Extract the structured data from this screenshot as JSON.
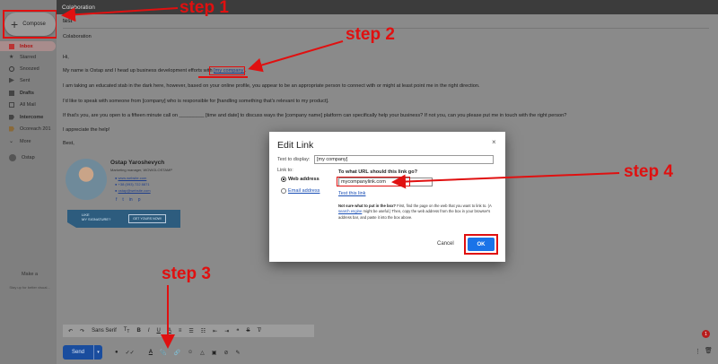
{
  "sidebar": {
    "compose_label": "Compose",
    "items": [
      {
        "label": "Inbox",
        "icon": "inbox-icon",
        "active": true
      },
      {
        "label": "Starred",
        "icon": "star-icon"
      },
      {
        "label": "Snoozed",
        "icon": "clock-icon"
      },
      {
        "label": "Sent",
        "icon": "send-icon"
      },
      {
        "label": "Drafts",
        "icon": "draft-icon"
      },
      {
        "label": "All Mail",
        "icon": "mail-icon"
      },
      {
        "label": "Intercome",
        "icon": "label-icon"
      },
      {
        "label": "Ocoreach 201",
        "icon": "label-icon"
      },
      {
        "label": "More",
        "icon": "chevron-down-icon"
      },
      {
        "label": "Ostap",
        "icon": "avatar-icon"
      }
    ],
    "footer_title": "Make a",
    "footer_text": "Stay up for better visual..."
  },
  "compose": {
    "window_title": "Colaboration",
    "to": "test",
    "subject_line": "Colaboration",
    "greeting": "Hi,",
    "p1_before": "My name is Ostap and I head up business development efforts with ",
    "p1_link": "[my company]",
    "p1_after": ".",
    "p2": "I am taking an educated stab in the dark here, however, based on your online profile, you appear to be an appropriate person to connect with    or might at least point me in the right direction.",
    "p3": "I'd like to speak with someone from [company] who is responsible for [handling something that's relevant to my product].",
    "p4": "If that's you, are you open to a fifteen minute call on _________ [time and date] to discuss ways the [company name] platform can specifically help your business? If not you, can you please put me in touch with the right person?",
    "p5": "I appreciate the help!",
    "signoff": "Best,"
  },
  "signature": {
    "name": "Ostap Yaroshevych",
    "title": "Marketing manager, WOWGLOSTAMP",
    "website": "www.website.com",
    "phone": "+38 (093) 722 8871",
    "email": "ostap@website.com",
    "social": [
      "f",
      "t",
      "in",
      "p"
    ],
    "banner_line1": "LIKE",
    "banner_line2": "MY SIGNATURE?",
    "banner_button": "GET YOURS NOW!"
  },
  "toolbar": {
    "font": "Sans Serif",
    "send_label": "Send",
    "notification_count": "1"
  },
  "dialog": {
    "title": "Edit Link",
    "close": "×",
    "text_to_display_label": "Text to display:",
    "text_to_display_value": "[my company]",
    "link_to_label": "Link to:",
    "web_address_label": "Web address",
    "email_address_label": "Email address",
    "url_question": "To what URL should this link go?",
    "url_value": "mycompanylink.com",
    "test_link": "Test this link",
    "help_bold": "Not sure what to put in the box?",
    "help_1": " First, find the page on the web that you want to link to. (A ",
    "help_link": "search engine",
    "help_2": " might be useful.) Then, copy the web address from the box in your browser's address bar, and paste it into the box above.",
    "cancel_label": "Cancel",
    "ok_label": "OK"
  },
  "annotations": {
    "step1": "step 1",
    "step2": "step 2",
    "step3": "step 3",
    "step4": "step 4",
    "color": "#e01010"
  }
}
